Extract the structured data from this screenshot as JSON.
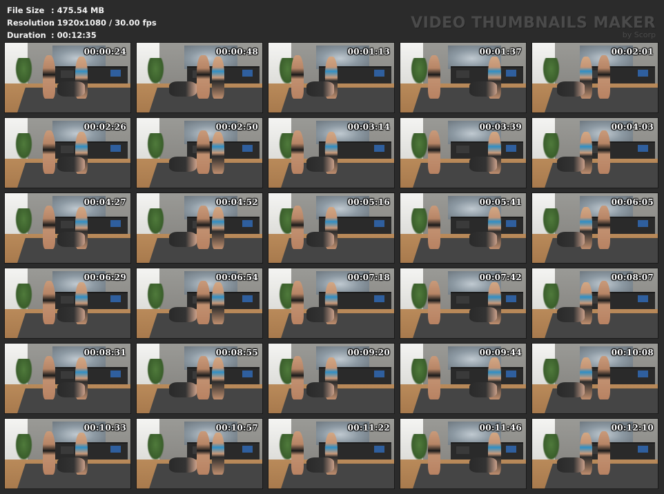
{
  "info": {
    "file_size_label": "File Size",
    "file_size_value": ": 475.54 MB",
    "resolution_label": "Resolution",
    "resolution_value": ": 1920x1080 / 30.00 fps",
    "duration_label": "Duration",
    "duration_value": ": 00:12:35"
  },
  "brand": {
    "title": "VIDEO THUMBNAILS MAKER",
    "subtitle": "by Scorp"
  },
  "thumbnails": [
    "00:00:24",
    "00:00:48",
    "00:01:13",
    "00:01:37",
    "00:02:01",
    "00:02:26",
    "00:02:50",
    "00:03:14",
    "00:03:39",
    "00:04:03",
    "00:04:27",
    "00:04:52",
    "00:05:16",
    "00:05:41",
    "00:06:05",
    "00:06:29",
    "00:06:54",
    "00:07:18",
    "00:07:42",
    "00:08:07",
    "00:08:31",
    "00:08:55",
    "00:09:20",
    "00:09:44",
    "00:10:08",
    "00:10:33",
    "00:10:57",
    "00:11:22",
    "00:11:46",
    "00:12:10"
  ]
}
